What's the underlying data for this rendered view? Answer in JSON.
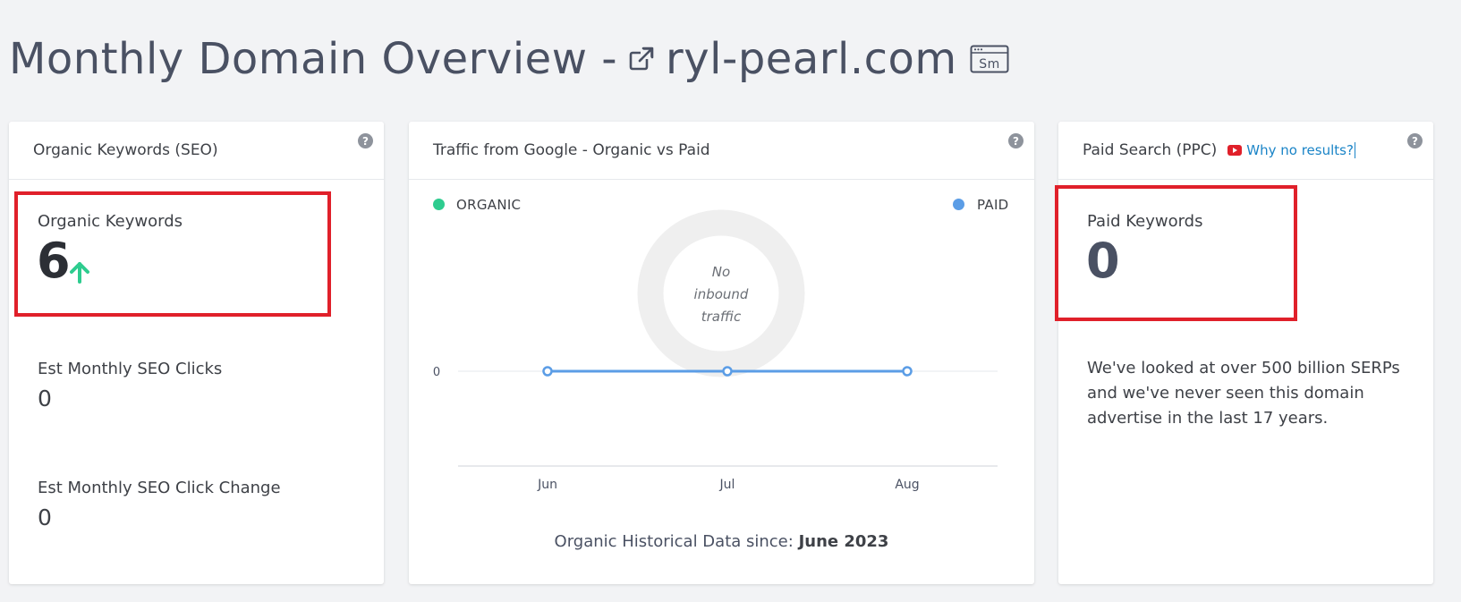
{
  "header": {
    "title_prefix": "Monthly Domain Overview -",
    "domain": "ryl-pearl.com",
    "sm_badge": "Sm"
  },
  "organic_card": {
    "title": "Organic Keywords (SEO)",
    "help": "?",
    "keywords_label": "Organic Keywords",
    "keywords_value": "6",
    "clicks_label": "Est Monthly SEO Clicks",
    "clicks_value": "0",
    "click_change_label": "Est Monthly SEO Click Change",
    "click_change_value": "0"
  },
  "traffic_card": {
    "title": "Traffic from Google - Organic vs Paid",
    "help": "?",
    "legend_organic": "ORGANIC",
    "legend_paid": "PAID",
    "donut_text_1": "No",
    "donut_text_2": "inbound",
    "donut_text_3": "traffic",
    "footnote_prefix": "Organic Historical Data since:",
    "footnote_date": "June 2023"
  },
  "ppc_card": {
    "title": "Paid Search (PPC)",
    "help": "?",
    "why_link": "Why no results?",
    "keywords_label": "Paid Keywords",
    "keywords_value": "0",
    "description": "We've looked at over 500 billion SERPs and we've never seen this domain advertise in the last 17 years."
  },
  "chart_data": {
    "type": "line",
    "categories": [
      "Jun",
      "Jul",
      "Aug"
    ],
    "series": [
      {
        "values": [
          0,
          0,
          0
        ],
        "color": "#5b9de6"
      }
    ],
    "y_ticks": [
      "0"
    ],
    "legend": [
      "ORGANIC",
      "PAID"
    ],
    "grid": true
  },
  "colors": {
    "organic": "#2ecc8f",
    "paid": "#5b9de6",
    "highlight": "#e0202a",
    "link": "#1a84c7"
  }
}
